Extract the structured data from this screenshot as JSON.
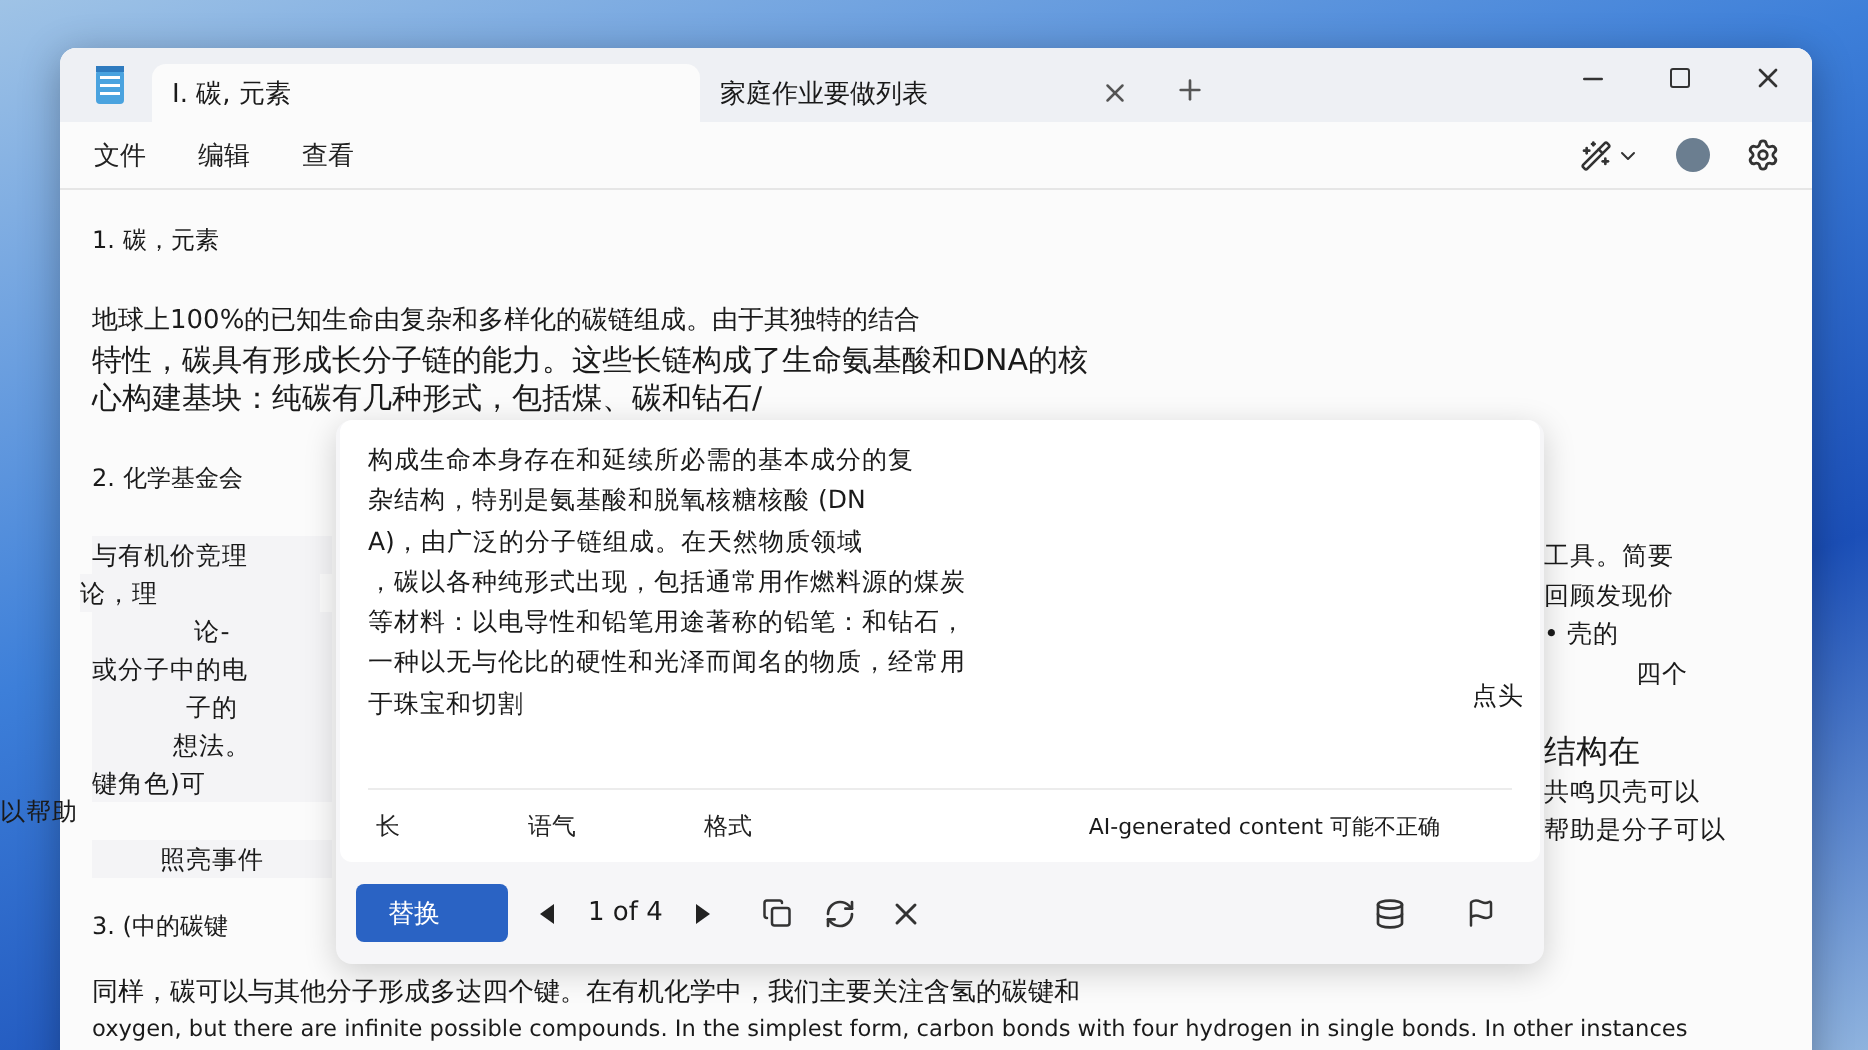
{
  "window": {
    "tabs": [
      {
        "label": "I. 碳, 元素",
        "selected": true
      },
      {
        "label": "家庭作业要做列表",
        "selected": false
      }
    ]
  },
  "menu": [
    "文件",
    "编辑",
    "查看"
  ],
  "document": {
    "heading_1": "1. 碳，元素",
    "paragraph_1": [
      {
        "kind": "small",
        "text": "地球上100%的已知生命由复杂和多样化的碳链组成。由于其独特的结合"
      },
      {
        "kind": "large",
        "text": "特性，碳具有形成长分子链的能力。这些长链构成了生命氨基酸和DNA的核"
      },
      {
        "kind": "large",
        "text": "心构建基块：纯碳有几种形式，包括煤、碳和钻石/"
      }
    ],
    "heading_2": "2. 化学基金会",
    "left_fragments": [
      {
        "kind": "left",
        "text": "与有机价竞理"
      },
      {
        "kind": "outdent",
        "text": "论，理"
      },
      {
        "kind": "center",
        "text": "论-"
      },
      {
        "kind": "left",
        "text": "或分子中的电"
      },
      {
        "kind": "center",
        "text": "子的"
      },
      {
        "kind": "center",
        "text": "想法。"
      },
      {
        "kind": "left",
        "text": "键角色)可"
      },
      {
        "kind": "gap",
        "text": "照亮事件"
      }
    ],
    "right_fragments": [
      {
        "kind": "plain",
        "text": "工具。简要"
      },
      {
        "kind": "plain",
        "text": "回顾发现价"
      },
      {
        "kind": "plain",
        "text": "• 壳的"
      },
      {
        "kind": "center",
        "text": "四个"
      },
      {
        "kind": "large",
        "text": "结构在"
      },
      {
        "kind": "plain",
        "text": "共鸣贝壳可以"
      },
      {
        "kind": "plain",
        "text": "帮助是分子可以"
      }
    ],
    "heading_3": "3. (中的碳键",
    "paragraph_3": [
      "同样，碳可以与其他分子形成多达四个键。在有机化学中，我们主要关注含氢的碳键和",
      "oxygen, but there are infinite possible compounds. In the simplest form, carbon bonds with four hydrogen in single bonds. In other instances"
    ]
  },
  "stray_text": "以帮助",
  "rewrite_panel": {
    "lines": [
      "构成生命本身存在和延续所必需的基本成分的复",
      "杂结构，特别是氨基酸和脱氧核糖核酸 (DN",
      "A)，由广泛的分子链组成。在天然物质领域",
      "，碳以各种纯形式出现，包括通常用作燃料源的煤炭",
      "等材料：以电导性和铅笔用途著称的铅笔：和钻石，",
      "一种以无与伦比的硬性和光泽而闻名的物质，经常用",
      "于珠宝和切割"
    ],
    "side_text": "点头",
    "options": [
      "长",
      "语气",
      "格式"
    ],
    "disclaimer": "AI-generated content 可能不正确",
    "replace_button": "替换",
    "pager": "1 of 4"
  }
}
